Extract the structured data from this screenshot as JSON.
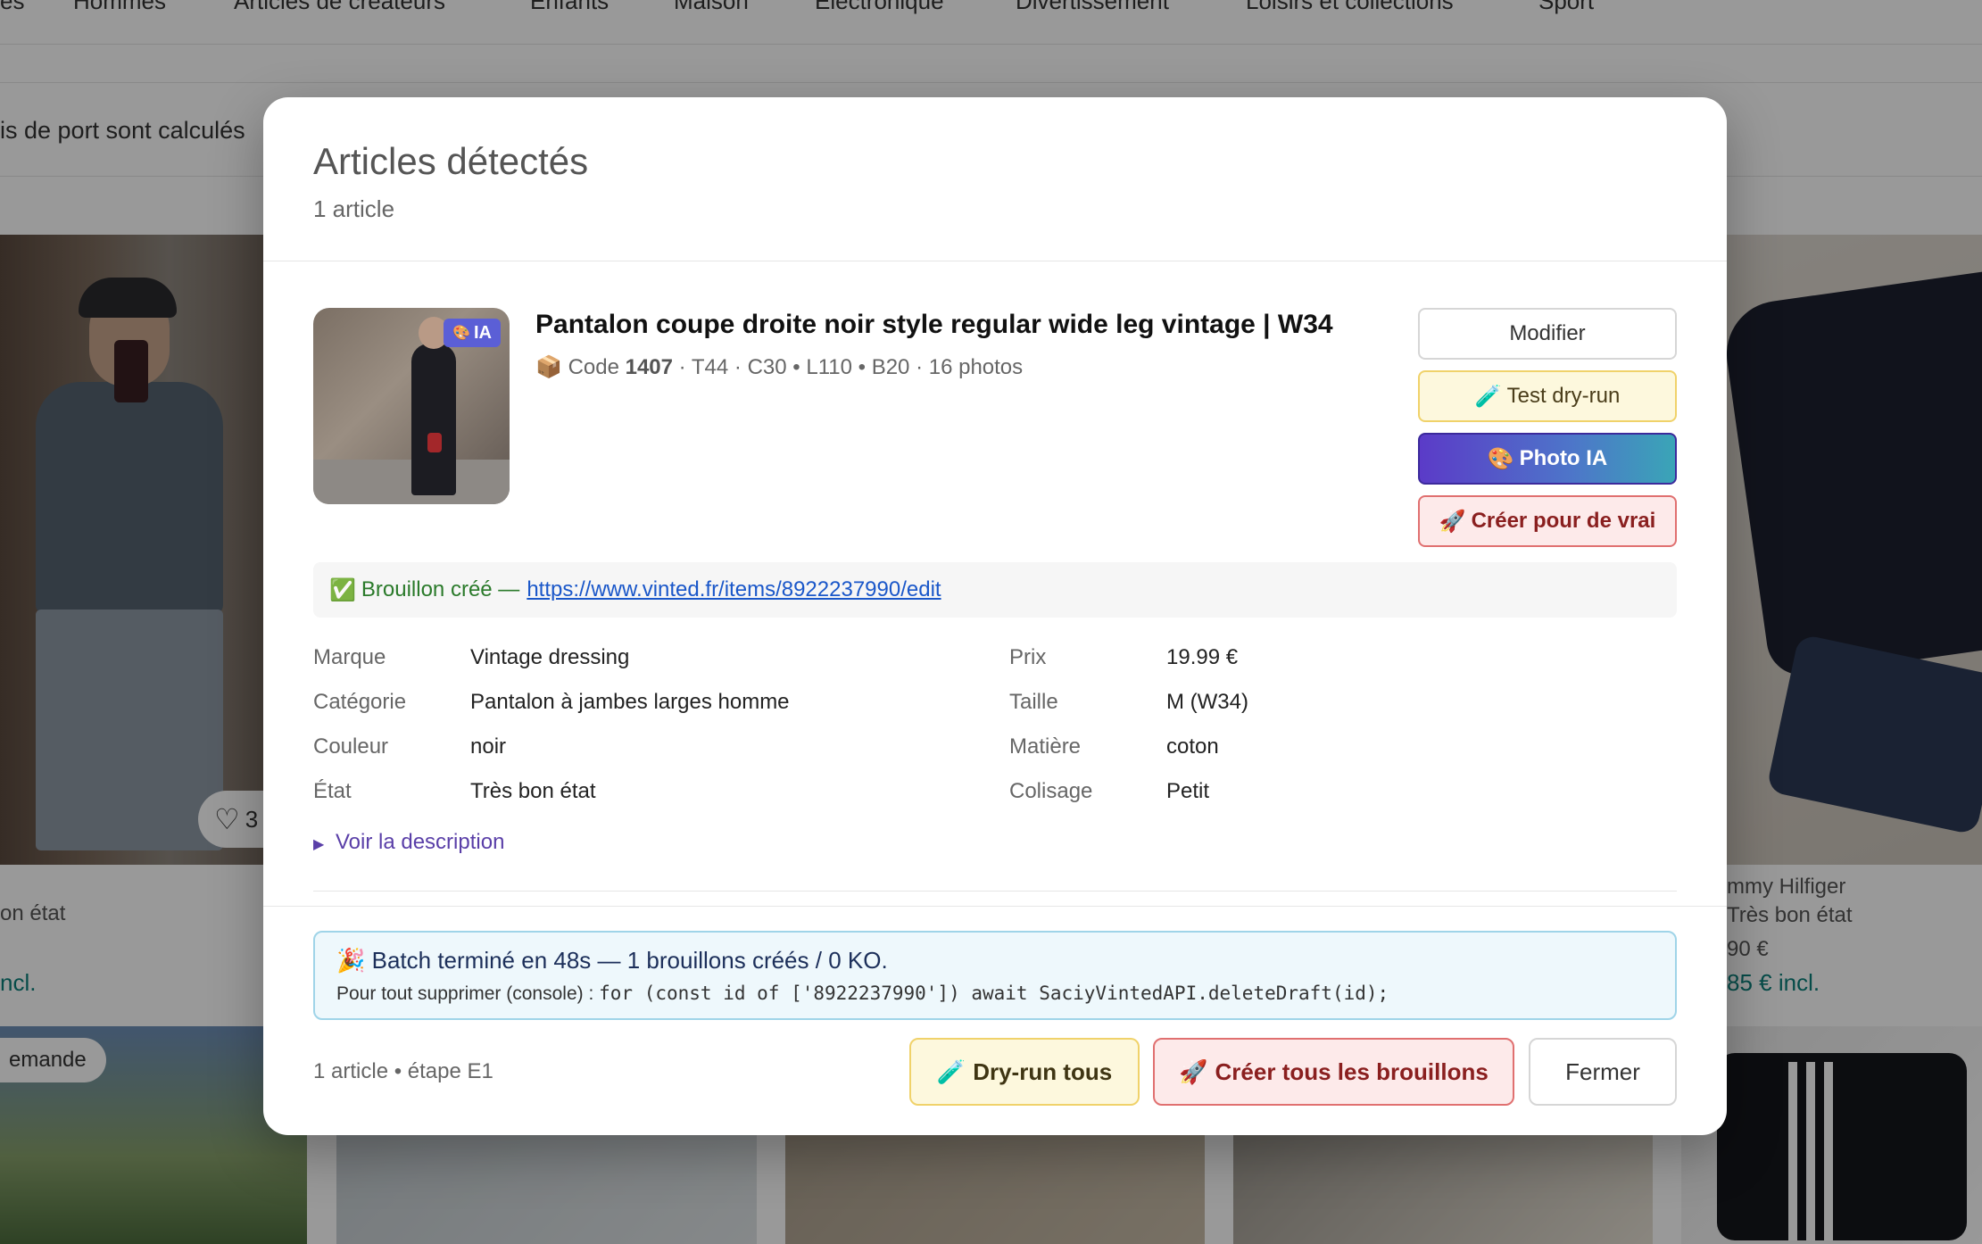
{
  "background": {
    "nav_items": [
      "Hommes",
      "Articles de créateurs",
      "Enfants",
      "Maison",
      "Électronique",
      "Divertissement",
      "Loisirs et collections",
      "Sport"
    ],
    "nav_partial_left": "es",
    "shipping_notice": "is de port sont calculés",
    "left_card": {
      "likes": "3",
      "condition": "on état",
      "price_incl": "ncl."
    },
    "right_card": {
      "brand": "mmy Hilfiger",
      "condition": "Très bon état",
      "price": "90 €",
      "price_incl": "85 € incl."
    },
    "badge_demande": "emande"
  },
  "modal": {
    "title": "Articles détectés",
    "subtitle": "1 article",
    "item": {
      "badge": "IA",
      "title": "Pantalon coupe droite noir style regular wide leg vintage | W34",
      "meta_prefix": "Code",
      "code": "1407",
      "meta_rest": "· T44 · C30 • L110 • B20 · 16 photos",
      "actions": {
        "modifier": "Modifier",
        "test": "Test dry-run",
        "photo": "Photo IA",
        "creer": "Créer pour de vrai"
      },
      "brouillon_text": "Brouillon créé —",
      "brouillon_link": "https://www.vinted.fr/items/8922237990/edit",
      "attributes_left": [
        {
          "label": "Marque",
          "value": "Vintage dressing"
        },
        {
          "label": "Catégorie",
          "value": "Pantalon à jambes larges homme"
        },
        {
          "label": "Couleur",
          "value": "noir"
        },
        {
          "label": "État",
          "value": "Très bon état"
        }
      ],
      "attributes_right": [
        {
          "label": "Prix",
          "value": "19.99 €"
        },
        {
          "label": "Taille",
          "value": "M (W34)"
        },
        {
          "label": "Matière",
          "value": "coton"
        },
        {
          "label": "Colisage",
          "value": "Petit"
        }
      ],
      "description_toggle": "Voir la description"
    },
    "batch": {
      "line1": "Batch terminé en 48s — 1 brouillons créés / 0 KO.",
      "line2_prefix": "Pour tout supprimer (console) :",
      "line2_code": "for (const id of ['8922237990']) await SaciyVintedAPI.deleteDraft(id);"
    },
    "footer": {
      "info": "1 article • étape E1",
      "dryrun_all": "Dry-run tous",
      "create_all": "Créer tous les brouillons",
      "close": "Fermer"
    }
  },
  "icons": {
    "package": "📦",
    "test_tube": "🧪",
    "palette": "🎨",
    "rocket": "🚀",
    "check": "✅",
    "party": "🎉",
    "heart": "♡",
    "triangle": "▶"
  },
  "colors": {
    "photo_btn_start": "#5b3bc8",
    "photo_btn_end": "#3aa5b7",
    "danger": "#e07070",
    "warning": "#f0d26a",
    "info_border": "#9fd4e8",
    "link": "#1a57c9",
    "success": "#2a7a2a"
  }
}
